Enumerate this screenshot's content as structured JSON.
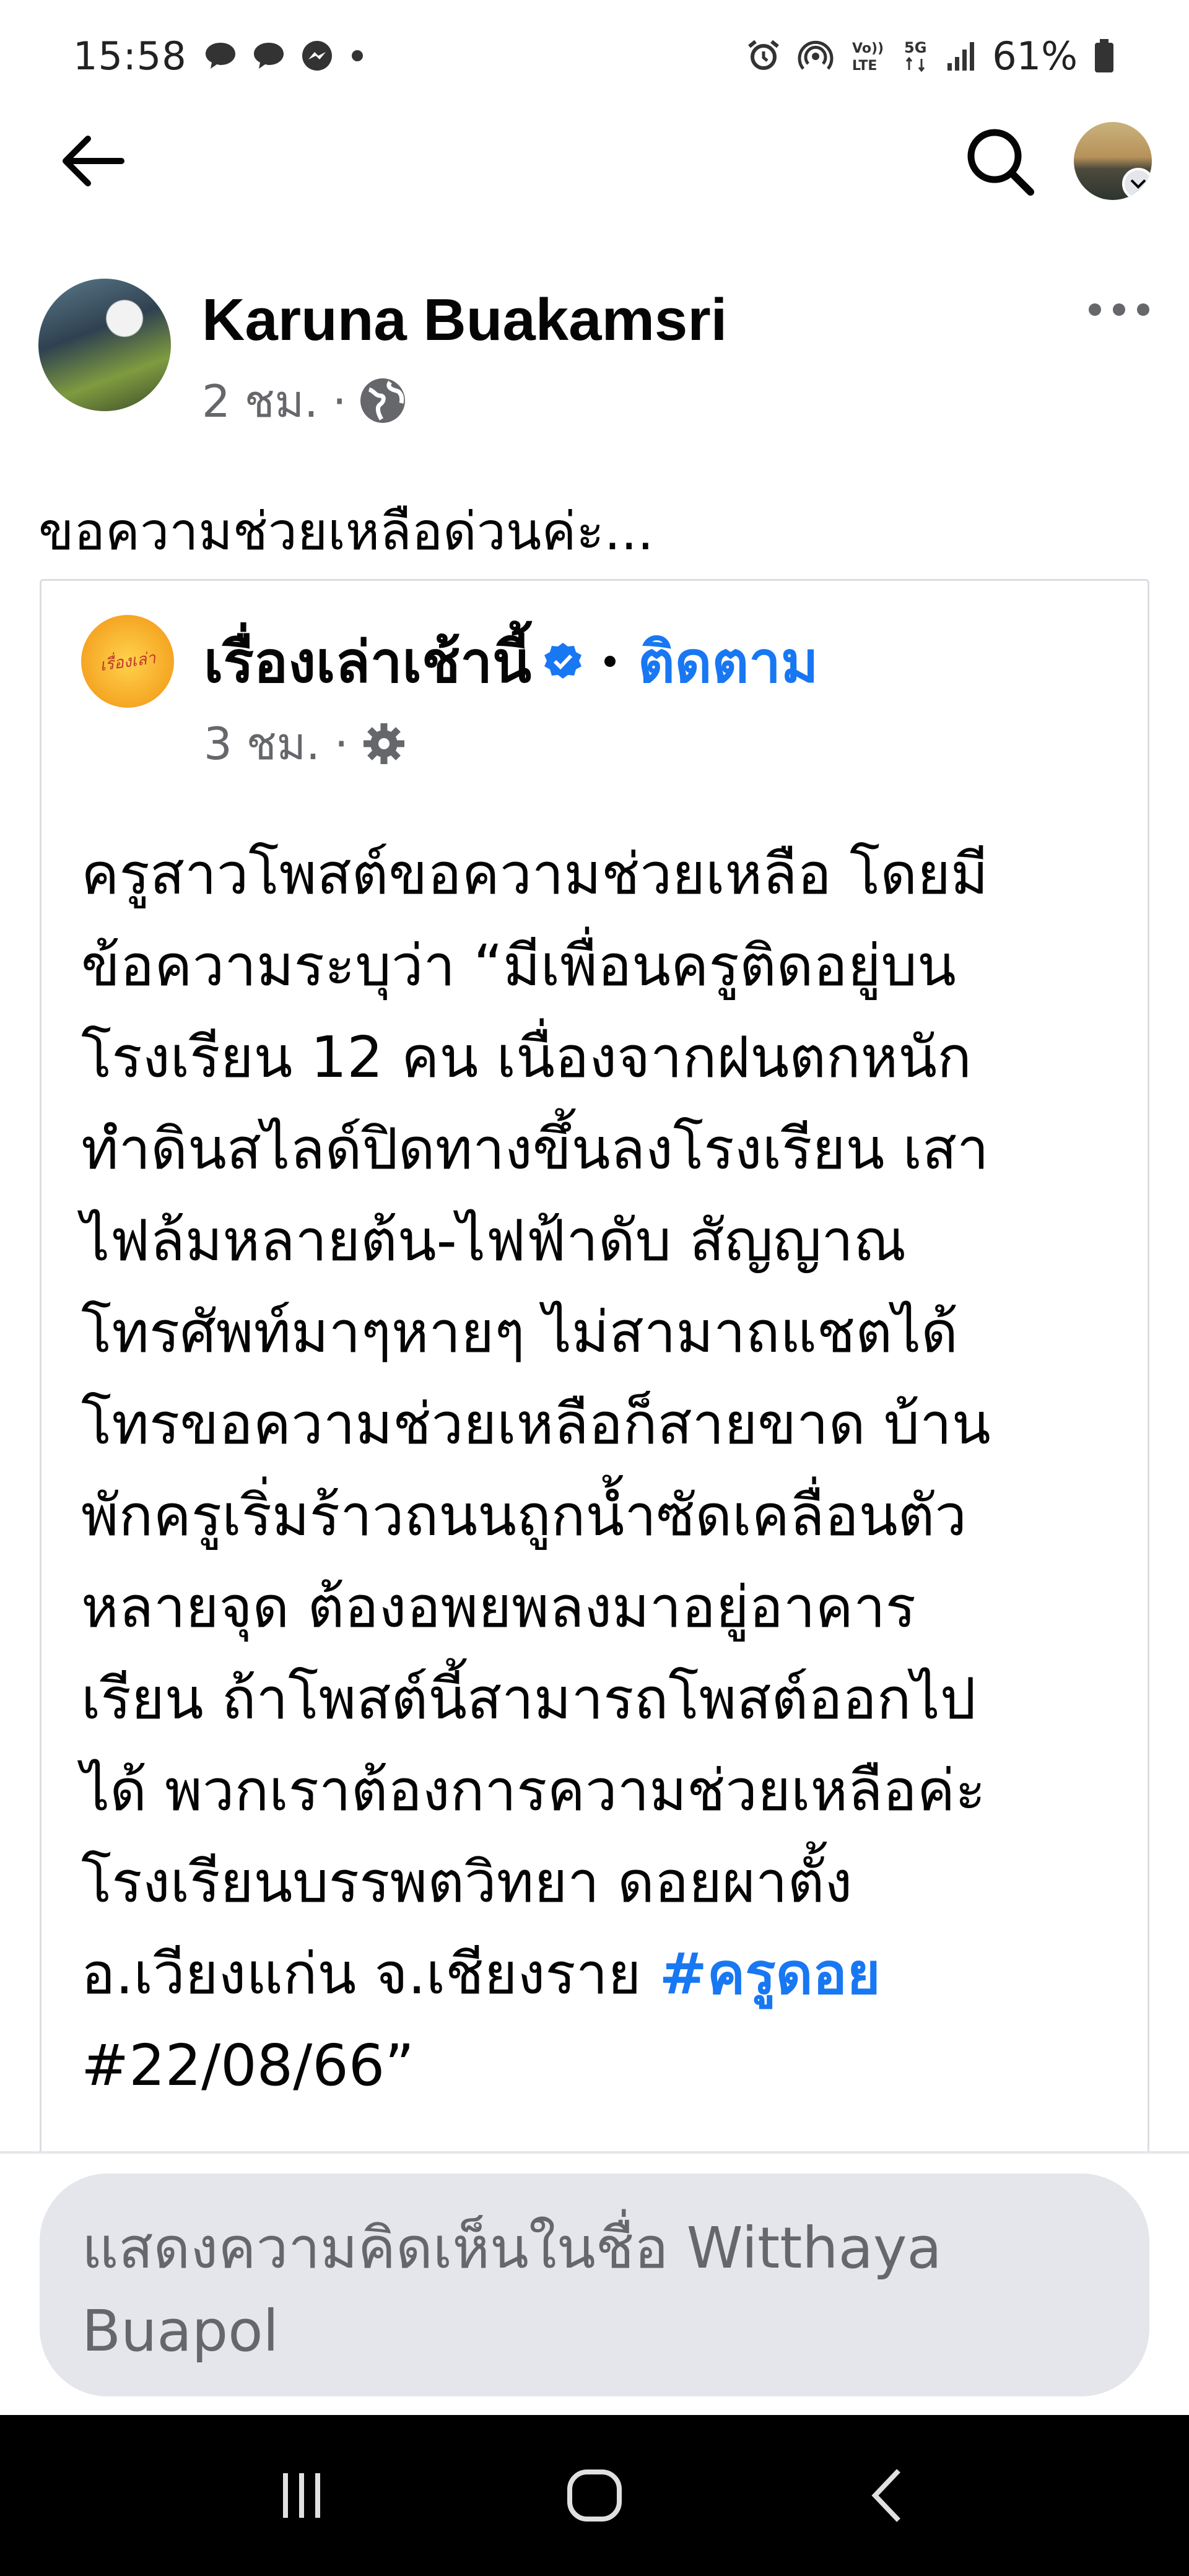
{
  "status_bar": {
    "time": "15:58",
    "battery": "61%",
    "network_label": "5G",
    "left_icons": [
      "chat-bubble-icon",
      "chat-bubble-icon",
      "messenger-icon",
      "dot-icon"
    ],
    "right_icons": [
      "alarm-icon",
      "hotspot-icon",
      "volte-icon",
      "5g-icon",
      "signal-icon",
      "battery-icon"
    ]
  },
  "header": {
    "back_icon": "arrow-left-icon",
    "search_icon": "search-icon"
  },
  "post": {
    "author": "Karuna Buakamsri",
    "time": "2 ชม. ·",
    "privacy_icon": "globe-icon",
    "caption": "ขอความช่วยเหลือด่วนค่ะ..."
  },
  "shared": {
    "page_name": "เรื่องเล่าเช้านี้",
    "follow": "ติดตาม",
    "time": "3 ชม. ·",
    "privacy_icon": "gear-icon",
    "body": "ครูสาวโพสต์ขอความช่วยเหลือ โดยมี\nข้อความระบุว่า “มีเพื่อนครูติดอยู่บน\nโรงเรียน 12 คน เนื่องจากฝนตกหนัก\nทำดินสไลด์ปิดทางขึ้นลงโรงเรียน เสา\nไฟล้มหลายต้น-ไฟฟ้าดับ สัญญาณ\nโทรศัพท์มาๆหายๆ ไม่สามาถแชตได้\nโทรขอความช่วยเหลือก็สายขาด บ้าน\nพักครูเริ่มร้าวถนนถูกน้ำซัดเคลื่อนตัว\nหลายจุด ต้องอพยพลงมาอยู่อาคาร\nเรียน ถ้าโพสต์นี้สามารถโพสต์ออกไป\nได้ พวกเราต้องการความช่วยเหลือค่ะ\nโรงเรียนบรรพตวิทยา ดอยผาตั้ง\nอ.เวียงแก่น จ.เชียงราย ",
    "hashtag": "#ครูดอย",
    "body_end": "\n#22/08/66”"
  },
  "comment": {
    "placeholder": "แสดงความคิดเห็นในชื่อ Witthaya Buapol"
  },
  "colors": {
    "accent": "#1877f2",
    "meta_text": "#65676b",
    "comment_bg": "#e4e6eb"
  }
}
